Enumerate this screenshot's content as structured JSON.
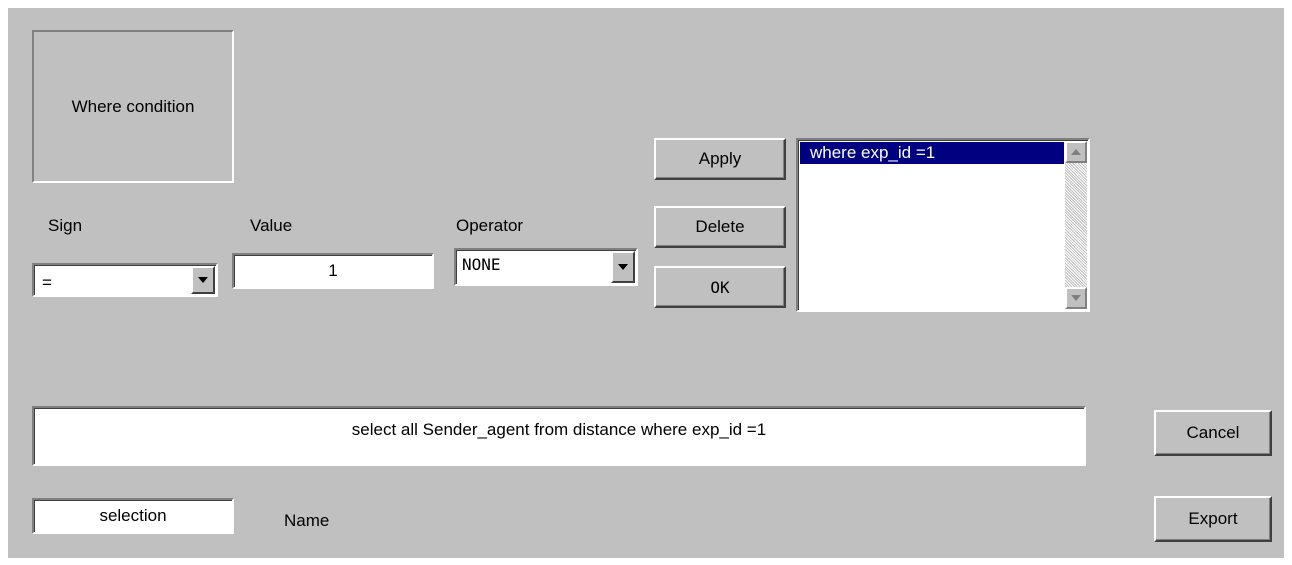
{
  "group_box": {
    "label": "Where condition"
  },
  "sign": {
    "label": "Sign",
    "value": "="
  },
  "value": {
    "label": "Value",
    "value": "1"
  },
  "operator": {
    "label": "Operator",
    "value": "NONE"
  },
  "buttons": {
    "apply": "Apply",
    "delete": "Delete",
    "ok": "OK",
    "cancel": "Cancel",
    "export": "Export"
  },
  "conditions_list": {
    "items": [
      "where exp_id =1"
    ],
    "selected_index": 0
  },
  "query": {
    "text": "select all Sender_agent from distance where exp_id =1"
  },
  "name": {
    "label": "Name",
    "value": "selection"
  },
  "icons": [
    "chevron-down-icon",
    "scroll-up-icon",
    "scroll-down-icon"
  ],
  "colors": {
    "panel_bg": "#c0c0c0",
    "selection_bg": "#000080",
    "selection_fg": "#ffffff"
  }
}
